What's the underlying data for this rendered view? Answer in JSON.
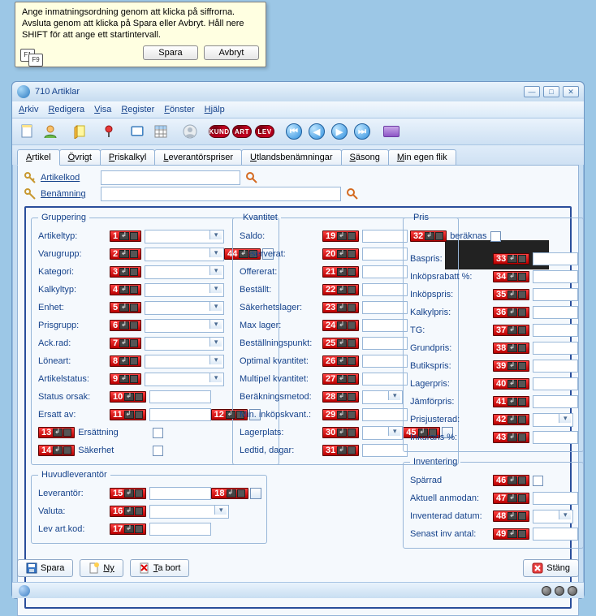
{
  "tooltip": {
    "text": "Ange inmatningsordning genom att klicka på siffrorna. Avsluta genom att klicka på Spara eller Avbryt. Håll nere SHIFT för att ange ett startintervall.",
    "save": "Spara",
    "cancel": "Avbryt"
  },
  "window": {
    "title": "710 Artiklar"
  },
  "menu": [
    "Arkiv",
    "Redigera",
    "Visa",
    "Register",
    "Fönster",
    "Hjälp"
  ],
  "toolbar_pills": [
    "KUND",
    "ART",
    "LEV"
  ],
  "tabs": [
    {
      "label": "Artikel",
      "ul": "A",
      "active": true
    },
    {
      "label": "Övrigt",
      "ul": "Ö"
    },
    {
      "label": "Priskalkyl",
      "ul": "P"
    },
    {
      "label": "Leverantörspriser",
      "ul": "L"
    },
    {
      "label": "Utlandsbenämningar",
      "ul": "U"
    },
    {
      "label": "Säsong",
      "ul": "S"
    },
    {
      "label": "Min egen flik",
      "ul": "M"
    }
  ],
  "search": {
    "code_label": "Artikelkod",
    "name_label": "Benämning"
  },
  "groups": {
    "gruppering": "Gruppering",
    "kvantitet": "Kvantitet",
    "pris": "Pris",
    "huvudlev": "Huvudleverantör",
    "inventering": "Inventering"
  },
  "gruppering": [
    {
      "n": "1",
      "label": "Artikeltyp:",
      "ctl": "combo"
    },
    {
      "n": "2",
      "label": "Varugrupp:",
      "ctl": "combo",
      "extra": "44"
    },
    {
      "n": "3",
      "label": "Kategori:",
      "ctl": "combo"
    },
    {
      "n": "4",
      "label": "Kalkyltyp:",
      "ctl": "combo"
    },
    {
      "n": "5",
      "label": "Enhet:",
      "ctl": "combo"
    },
    {
      "n": "6",
      "label": "Prisgrupp:",
      "ctl": "combo"
    },
    {
      "n": "7",
      "label": "Ack.rad:",
      "ctl": "combo"
    },
    {
      "n": "8",
      "label": "Löneart:",
      "ctl": "combo"
    },
    {
      "n": "9",
      "label": "Artikelstatus:",
      "ctl": "combo"
    },
    {
      "n": "10",
      "label": "Status orsak:",
      "ctl": "text"
    },
    {
      "n": "11",
      "label": "Ersatt av:",
      "ctl": "text",
      "extra": "12"
    }
  ],
  "gruppering_checks": [
    {
      "n": "13",
      "label": "Ersättning"
    },
    {
      "n": "14",
      "label": "Säkerhet"
    }
  ],
  "huvudlev": [
    {
      "n": "15",
      "label": "Leverantör:",
      "ctl": "text",
      "extra": "18"
    },
    {
      "n": "16",
      "label": "Valuta:",
      "ctl": "combo"
    },
    {
      "n": "17",
      "label": "Lev art.kod:",
      "ctl": "text"
    }
  ],
  "kvantitet": [
    {
      "n": "19",
      "label": "Saldo:"
    },
    {
      "n": "20",
      "label": "Reserverat:"
    },
    {
      "n": "21",
      "label": "Offererat:"
    },
    {
      "n": "22",
      "label": "Beställt:"
    },
    {
      "n": "23",
      "label": "Säkerhetslager:"
    },
    {
      "n": "24",
      "label": "Max lager:"
    },
    {
      "n": "25",
      "label": "Beställningspunkt:"
    },
    {
      "n": "26",
      "label": "Optimal kvantitet:"
    },
    {
      "n": "27",
      "label": "Multipel kvantitet:"
    },
    {
      "n": "28",
      "label": "Beräkningsmetod:",
      "ctl": "combo"
    },
    {
      "n": "29",
      "label": "Min. inköpskvant.:"
    },
    {
      "n": "30",
      "label": "Lagerplats:",
      "ctl": "combo",
      "extra": "45"
    },
    {
      "n": "31",
      "label": "Ledtid, dagar:"
    }
  ],
  "pris_top": {
    "n": "32",
    "label": "Momsberäknas"
  },
  "pris": [
    {
      "n": "33",
      "label": "Baspris:"
    },
    {
      "n": "34",
      "label": "Inköpsrabatt %:"
    },
    {
      "n": "35",
      "label": "Inköpspris:"
    },
    {
      "n": "36",
      "label": "Kalkylpris:"
    },
    {
      "n": "37",
      "label": "TG:"
    },
    {
      "n": "38",
      "label": "Grundpris:"
    },
    {
      "n": "39",
      "label": "Butikspris:"
    },
    {
      "n": "40",
      "label": "Lagerpris:"
    },
    {
      "n": "41",
      "label": "Jämförpris:"
    },
    {
      "n": "42",
      "label": "Prisjusterad:",
      "ctl": "combo"
    },
    {
      "n": "43",
      "label": "Inkurans %:"
    }
  ],
  "inventering": [
    {
      "n": "46",
      "label": "Spärrad",
      "ctl": "check"
    },
    {
      "n": "47",
      "label": "Aktuell anmodan:"
    },
    {
      "n": "48",
      "label": "Inventerad datum:",
      "ctl": "combo"
    },
    {
      "n": "49",
      "label": "Senast inv antal:"
    }
  ],
  "bottom": {
    "save": "Spara",
    "new": "Ny",
    "delete": "Ta bort",
    "close": "Stäng"
  }
}
